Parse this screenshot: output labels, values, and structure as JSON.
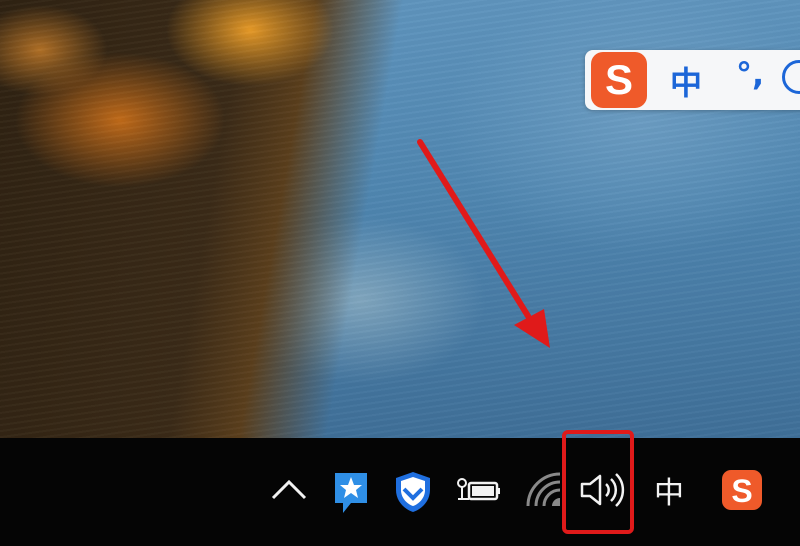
{
  "ime_bar": {
    "logo_letter": "S",
    "mode_label": "中",
    "punct_label": "°,"
  },
  "taskbar": {
    "ime_indicator": "中",
    "sogou_letter": "S"
  },
  "colors": {
    "annotation": "#e01a1a",
    "sogou_orange": "#ef5a2a",
    "ime_blue": "#1c66d8",
    "taskbar": "#050505"
  },
  "icons": [
    "chevron-up-icon",
    "star-badge-icon",
    "shield-check-icon",
    "battery-icon",
    "wifi-icon",
    "speaker-icon",
    "sogou-icon"
  ]
}
